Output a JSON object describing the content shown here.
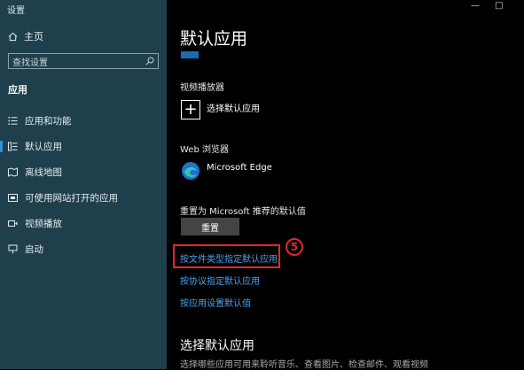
{
  "window": {
    "title": "设置",
    "controls": {
      "minimize": "—",
      "maximize": "□"
    }
  },
  "sidebar": {
    "home_label": "主页",
    "search_placeholder": "查找设置",
    "section_label": "应用",
    "items": [
      {
        "label": "应用和功能",
        "icon": "apps-features-icon"
      },
      {
        "label": "默认应用",
        "icon": "default-apps-icon",
        "selected": true
      },
      {
        "label": "离线地图",
        "icon": "offline-maps-icon"
      },
      {
        "label": "可使用网站打开的应用",
        "icon": "apps-for-websites-icon"
      },
      {
        "label": "视频播放",
        "icon": "video-playback-icon"
      },
      {
        "label": "启动",
        "icon": "startup-icon"
      }
    ]
  },
  "main": {
    "page_title": "默认应用",
    "video_player": {
      "label": "视频播放器",
      "value": "选择默认应用",
      "icon": "plus-icon",
      "icon_glyph": "+"
    },
    "web_browser": {
      "label": "Web 浏览器",
      "value": "Microsoft Edge",
      "icon": "edge-icon"
    },
    "reset": {
      "label": "重置为 Microsoft 推荐的默认值",
      "button_label": "重置"
    },
    "links": [
      {
        "label": "按文件类型指定默认应用",
        "highlighted": true
      },
      {
        "label": "按协议指定默认应用"
      },
      {
        "label": "按应用设置默认值"
      }
    ],
    "annotation": {
      "step": "5",
      "color": "#e0282e"
    },
    "choose_section": {
      "title": "选择默认应用",
      "description": "选择哪些应用可用来聆听音乐、查看图片、检查邮件、观看视频"
    }
  },
  "colors": {
    "sidebar_bg": "#1f3f4c",
    "main_bg": "#000000",
    "link": "#4aa3f0",
    "accent": "#2b93d9"
  }
}
